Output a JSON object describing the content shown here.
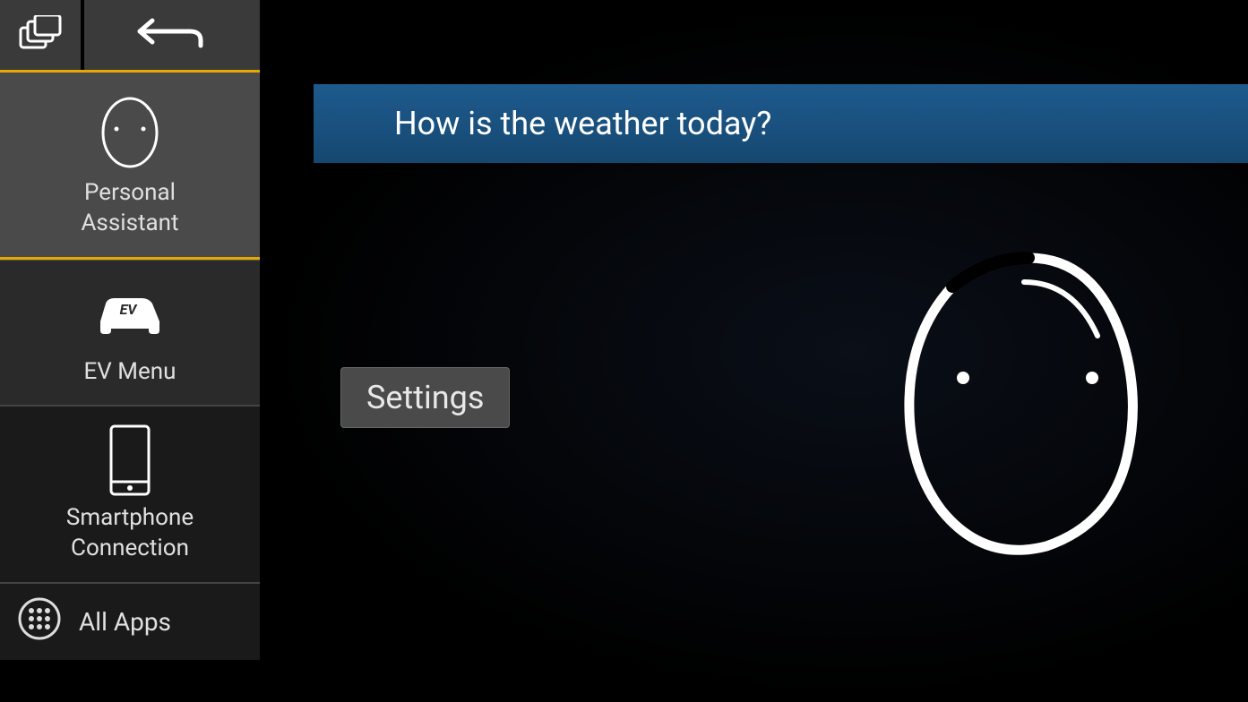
{
  "sidebar": {
    "items": [
      {
        "label": "Personal\nAssistant",
        "icon": "assistant-face-icon",
        "active": true
      },
      {
        "label": "EV Menu",
        "icon": "ev-car-icon",
        "active": false
      },
      {
        "label": "Smartphone\nConnection",
        "icon": "smartphone-icon",
        "active": false
      }
    ],
    "all_apps_label": "All Apps"
  },
  "main": {
    "query_text": "How is the weather today?",
    "settings_button_label": "Settings"
  },
  "colors": {
    "accent": "#e8a800",
    "query_bar": "#1a5486",
    "button_bg": "#4a4a4a"
  }
}
